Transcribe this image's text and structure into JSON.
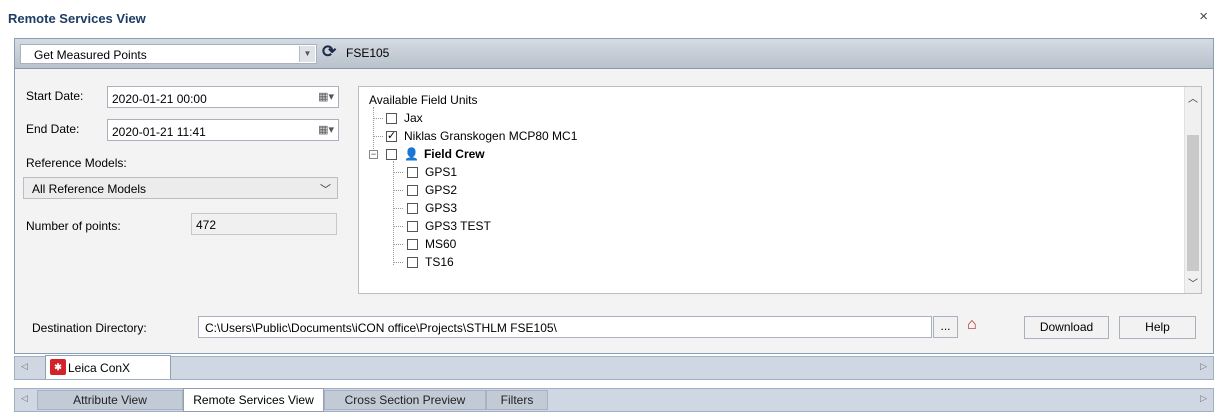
{
  "window": {
    "title": "Remote Services View",
    "close_glyph": "×"
  },
  "header": {
    "operation": "Get Measured Points",
    "project": "FSE105"
  },
  "form": {
    "start_label": "Start Date:",
    "start_value": "2020-01-21 00:00",
    "end_label": "End Date:",
    "end_value": "2020-01-21 11:41",
    "ref_label": "Reference Models:",
    "ref_value": "All Reference Models",
    "points_label": "Number of points:",
    "points_value": "472"
  },
  "tree": {
    "header": "Available Field Units",
    "items": [
      {
        "label": "Jax",
        "checked": false
      },
      {
        "label": "Niklas Granskogen MCP80 MC1",
        "checked": true
      },
      {
        "label": "Field Crew",
        "checked": false,
        "group": true
      },
      {
        "label": "GPS1",
        "checked": false
      },
      {
        "label": "GPS2",
        "checked": false
      },
      {
        "label": "GPS3",
        "checked": false
      },
      {
        "label": "GPS3 TEST",
        "checked": false
      },
      {
        "label": "MS60",
        "checked": false
      },
      {
        "label": "TS16",
        "checked": false
      }
    ]
  },
  "dest": {
    "label": "Destination Directory:",
    "value": "C:\\Users\\Public\\Documents\\iCON office\\Projects\\STHLM FSE105\\",
    "browse": "...",
    "download": "Download",
    "help": "Help"
  },
  "tabs_top": [
    {
      "label": "Leica ConX"
    }
  ],
  "tabs_bottom": [
    {
      "label": "Attribute View"
    },
    {
      "label": "Remote Services View"
    },
    {
      "label": "Cross Section Preview"
    },
    {
      "label": "Filters"
    }
  ],
  "icons": {
    "refresh": "refresh-icon",
    "calendar": "calendar-icon",
    "home": "home-icon",
    "crew": "person-icon",
    "leica": "leica-logo"
  }
}
